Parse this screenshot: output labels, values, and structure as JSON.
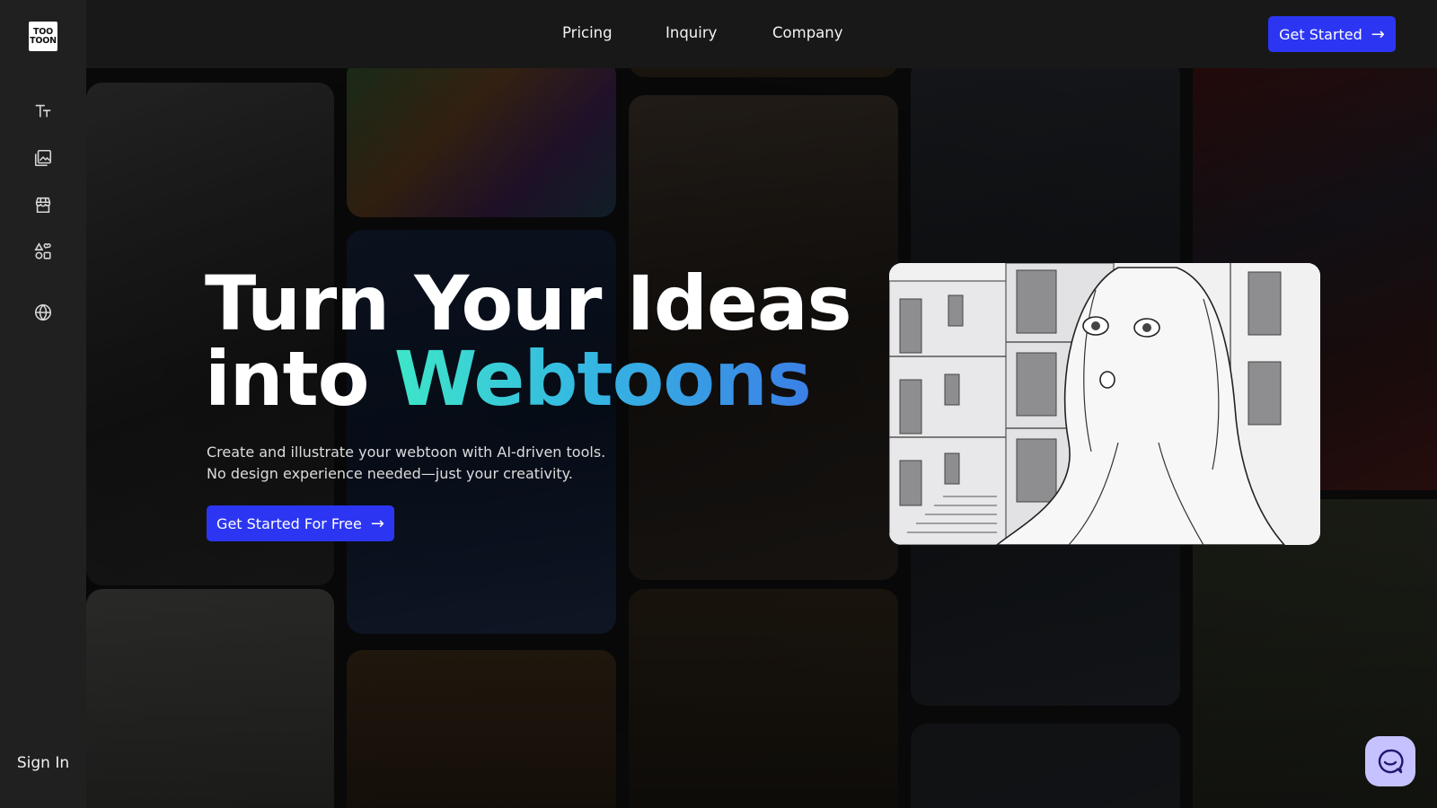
{
  "brand": {
    "logo_line1": "TOO",
    "logo_line2": "TOON"
  },
  "sidebar": {
    "items": [
      {
        "icon": "text-icon"
      },
      {
        "icon": "gallery-icon"
      },
      {
        "icon": "store-icon"
      },
      {
        "icon": "shapes-icon"
      },
      {
        "icon": "globe-icon"
      }
    ],
    "signin_label": "Sign In"
  },
  "nav": {
    "links": [
      "Pricing",
      "Inquiry",
      "Company"
    ],
    "cta_label": "Get Started",
    "cta_arrow": "→"
  },
  "hero": {
    "title_line1": "Turn Your Ideas",
    "title_line2_plain": "into ",
    "title_line2_accent": "Webtoons",
    "subtitle_line1": "Create and illustrate your webtoon with AI-driven tools.",
    "subtitle_line2": "No design experience needed—just your creativity.",
    "cta_label": "Get Started For Free",
    "cta_arrow": "→"
  },
  "colors": {
    "accent": "#2c36f2",
    "gradient_start": "#3ee6c8",
    "gradient_end": "#3b7fe6",
    "chat_bubble": "#c6c2ff"
  }
}
